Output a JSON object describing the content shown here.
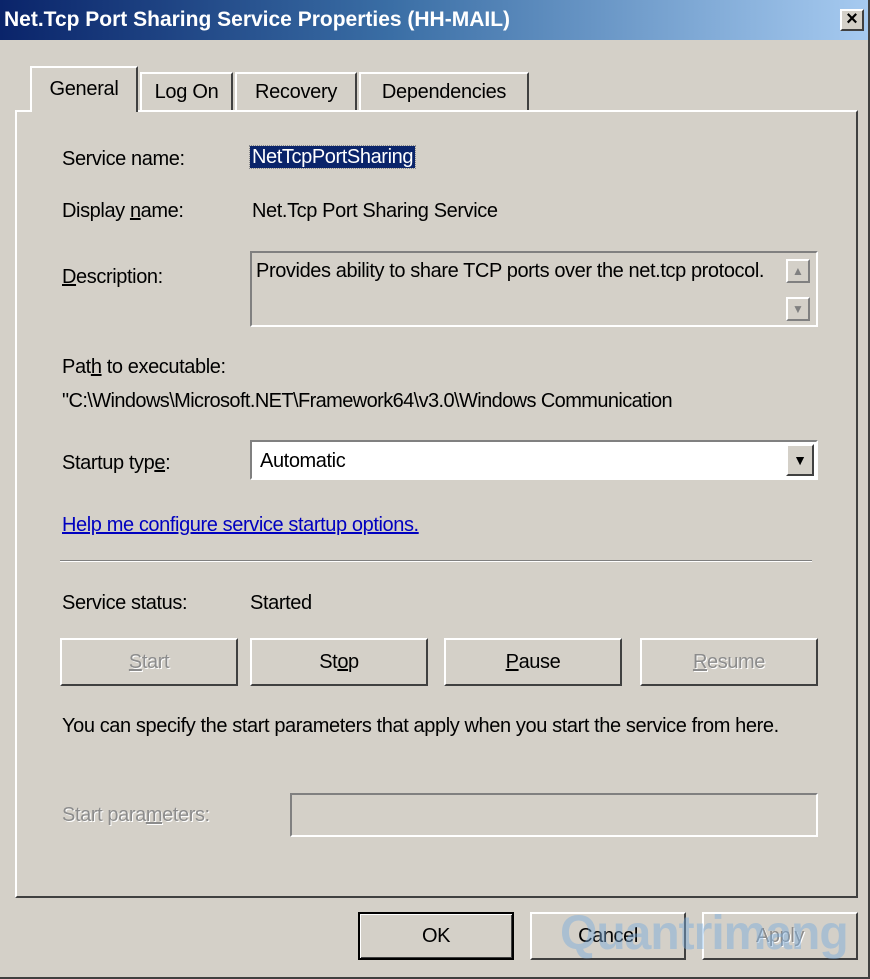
{
  "window": {
    "title": "Net.Tcp Port Sharing Service Properties (HH-MAIL)",
    "close_label": "×"
  },
  "tabs": [
    {
      "label": "General",
      "active": true
    },
    {
      "label": "Log On",
      "active": false
    },
    {
      "label": "Recovery",
      "active": false
    },
    {
      "label": "Dependencies",
      "active": false
    }
  ],
  "general": {
    "service_name_label": "Service name:",
    "service_name_value": "NetTcpPortSharing",
    "display_name_label_pre": "Display ",
    "display_name_label_u": "n",
    "display_name_label_post": "ame:",
    "display_name_value": "Net.Tcp Port Sharing Service",
    "description_label_u": "D",
    "description_label_post": "escription:",
    "description_value": "Provides ability to share TCP ports over the net.tcp protocol.",
    "path_label_pre": "Pat",
    "path_label_u": "h",
    "path_label_post": " to executable:",
    "path_value": "\"C:\\Windows\\Microsoft.NET\\Framework64\\v3.0\\Windows Communication",
    "startup_label_pre": "Startup typ",
    "startup_label_u": "e",
    "startup_label_post": ":",
    "startup_value": "Automatic",
    "help_link": "Help me configure service startup options.",
    "status_label": "Service status:",
    "status_value": "Started",
    "info_text": "You can specify the start parameters that apply when you start the service from here.",
    "params_label_pre": "Start para",
    "params_label_u": "m",
    "params_label_post": "eters:",
    "params_value": ""
  },
  "service_buttons": [
    {
      "u": "S",
      "rest": "tart",
      "pre": "",
      "enabled": false,
      "name": "start-button"
    },
    {
      "pre": "St",
      "u": "o",
      "rest": "p",
      "enabled": true,
      "name": "stop-button"
    },
    {
      "pre": "",
      "u": "P",
      "rest": "ause",
      "enabled": true,
      "name": "pause-button"
    },
    {
      "pre": "",
      "u": "R",
      "rest": "esume",
      "enabled": false,
      "name": "resume-button"
    }
  ],
  "footer": {
    "ok_label": "OK",
    "cancel_label": "Cancel",
    "apply_label": "Apply"
  },
  "watermark": "Quantrimang",
  "icons": {
    "scroll_up": "scroll-up-arrow-icon",
    "scroll_down": "scroll-down-arrow-icon",
    "dropdown": "chevron-down-icon"
  }
}
